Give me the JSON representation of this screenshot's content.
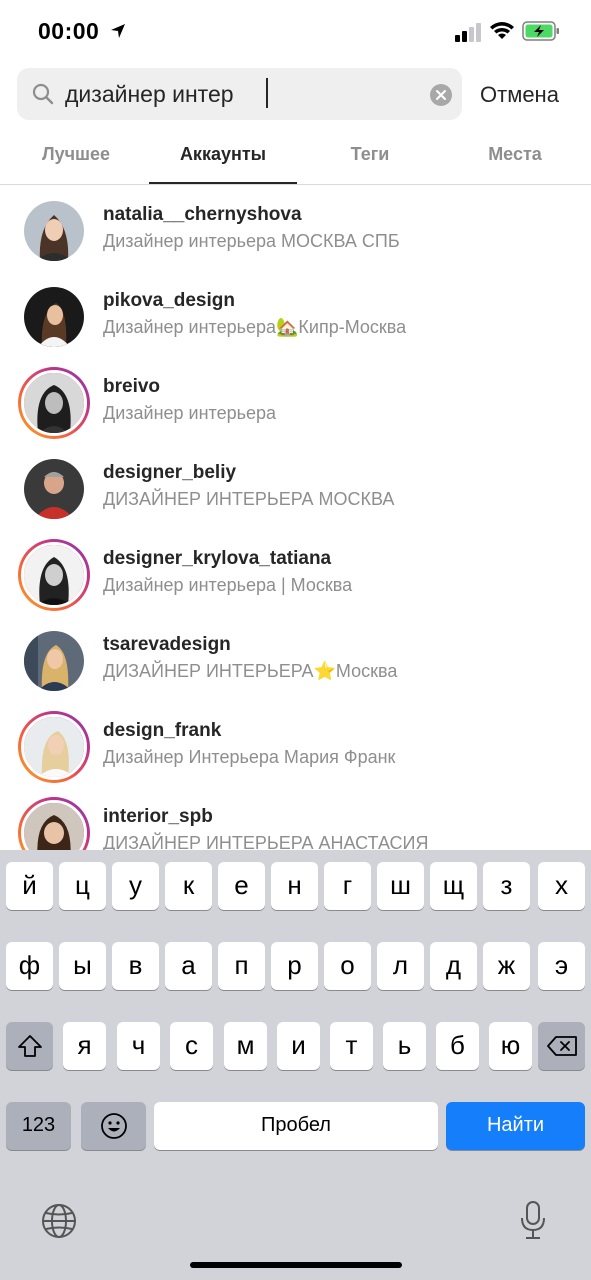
{
  "status_bar": {
    "time": "00:00"
  },
  "search": {
    "query": "дизайнер интер",
    "cancel_label": "Отмена"
  },
  "tabs": [
    {
      "label": "Лучшее"
    },
    {
      "label": "Аккаунты"
    },
    {
      "label": "Теги"
    },
    {
      "label": "Места"
    }
  ],
  "results": [
    {
      "username": "natalia__chernyshova",
      "bio": "Дизайнер интерьера МОСКВА СПБ",
      "story_ring": false
    },
    {
      "username": "pikova_design",
      "bio": "Дизайнер интерьера🏡Кипр-Москва",
      "story_ring": false
    },
    {
      "username": "breivo",
      "bio": "Дизайнер интерьера",
      "story_ring": true
    },
    {
      "username": "designer_beliy",
      "bio": "ДИЗАЙНЕР ИНТЕРЬЕРА МОСКВА",
      "story_ring": false
    },
    {
      "username": "designer_krylova_tatiana",
      "bio": "Дизайнер интерьера | Москва",
      "story_ring": true
    },
    {
      "username": "tsarevadesign",
      "bio": "ДИЗАЙНЕР ИНТЕРЬЕРА⭐️Москва",
      "story_ring": false
    },
    {
      "username": "design_frank",
      "bio": "Дизайнер Интерьера Мария Франк",
      "story_ring": true
    },
    {
      "username": "interior_spb",
      "bio": "ДИЗАЙНЕР ИНТЕРЬЕРА АНАСТАСИЯ",
      "story_ring": true
    }
  ],
  "keyboard": {
    "row1": [
      "й",
      "ц",
      "у",
      "к",
      "е",
      "н",
      "г",
      "ш",
      "щ",
      "з",
      "х"
    ],
    "row2": [
      "ф",
      "ы",
      "в",
      "а",
      "п",
      "р",
      "о",
      "л",
      "д",
      "ж",
      "э"
    ],
    "row3": [
      "я",
      "ч",
      "с",
      "м",
      "и",
      "т",
      "ь",
      "б",
      "ю"
    ],
    "numbers_label": "123",
    "space_label": "Пробел",
    "go_label": "Найти"
  },
  "colors": {
    "accent": "#147efb",
    "ring_start": "#f9a825",
    "ring_end": "#833ab4"
  }
}
